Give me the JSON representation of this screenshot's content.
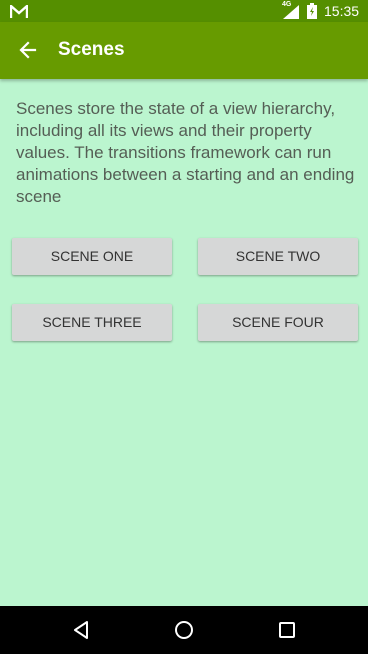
{
  "status_bar": {
    "network_type": "4G",
    "time": "15:35",
    "icons": [
      "gmail-icon",
      "signal-icon",
      "battery-icon"
    ]
  },
  "app_bar": {
    "title": "Scenes",
    "back_icon": "arrow-back-icon"
  },
  "description": "Scenes store the state of a view hierarchy, including all its views and their property values. The transitions framework can run animations between a starting and an ending scene",
  "buttons": [
    {
      "label": "SCENE ONE"
    },
    {
      "label": "SCENE TWO"
    },
    {
      "label": "SCENE THREE"
    },
    {
      "label": "SCENE FOUR"
    }
  ],
  "nav_bar": {
    "icons": [
      "nav-back-icon",
      "nav-home-icon",
      "nav-recents-icon"
    ]
  },
  "colors": {
    "status_bar": "#558f00",
    "app_bar": "#679b00",
    "background": "#bbf5cf",
    "button": "#d6d7d7",
    "text": "#555e55"
  }
}
